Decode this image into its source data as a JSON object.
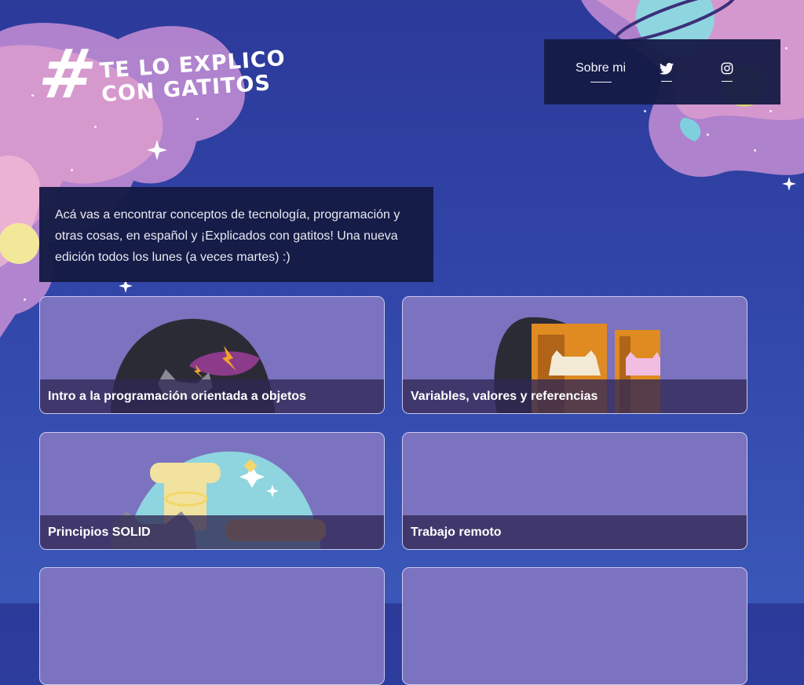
{
  "header": {
    "logo_hash": "#",
    "logo_line1": "TE LO EXPLICO",
    "logo_line2": "CON GATITOS"
  },
  "nav": {
    "about_label": "Sobre mi",
    "twitter_icon": "twitter-icon",
    "instagram_icon": "instagram-icon"
  },
  "intro": {
    "text": "Acá vas a encontrar conceptos de tecnología, programación y otras cosas, en español y ¡Explicados con gatitos! Una nueva edición todos los lunes (a veces martes) :)"
  },
  "cards": [
    {
      "title": "Intro a la programación orientada a objetos"
    },
    {
      "title": "Variables, valores y referencias"
    },
    {
      "title": "Principios SOLID"
    },
    {
      "title": "Trabajo remoto"
    },
    {
      "title": ""
    },
    {
      "title": ""
    }
  ],
  "colors": {
    "background": "#2f40a3",
    "panel": "#141b45",
    "card": "#7b73bf",
    "caption": "#302855"
  }
}
